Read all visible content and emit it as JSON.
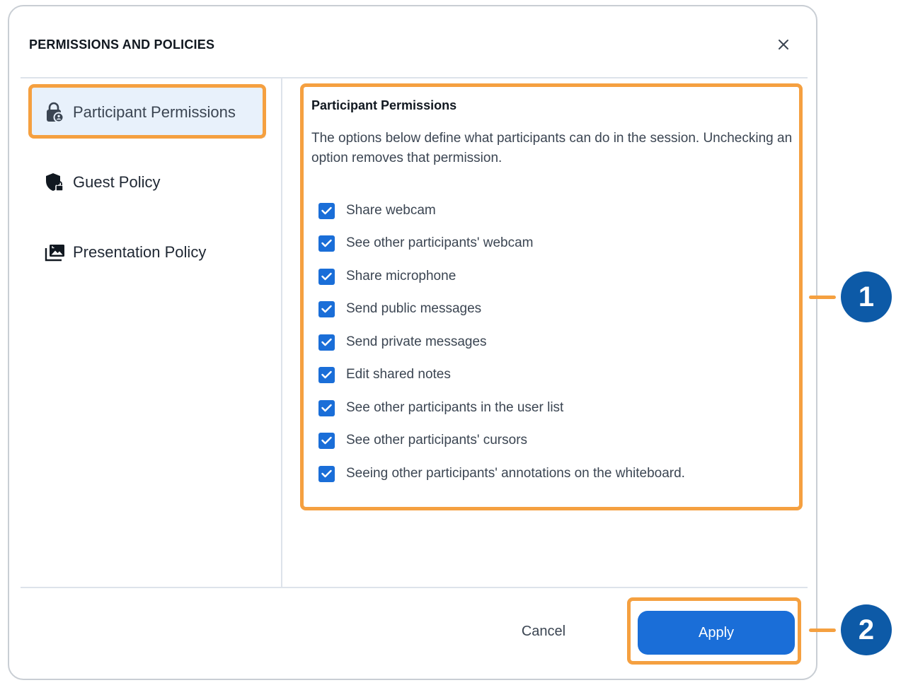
{
  "dialog": {
    "title": "PERMISSIONS AND POLICIES",
    "close_icon": "close-icon"
  },
  "sidebar": {
    "items": [
      {
        "label": "Participant Permissions",
        "icon": "lock-person-icon",
        "active": true
      },
      {
        "label": "Guest Policy",
        "icon": "shield-lock-icon",
        "active": false
      },
      {
        "label": "Presentation Policy",
        "icon": "image-stack-icon",
        "active": false
      }
    ]
  },
  "content": {
    "title": "Participant Permissions",
    "description": "The options below define what participants can do in the session. Unchecking an option removes that permission.",
    "permissions": [
      {
        "label": "Share webcam",
        "checked": true
      },
      {
        "label": "See other participants' webcam",
        "checked": true
      },
      {
        "label": "Share microphone",
        "checked": true
      },
      {
        "label": "Send public messages",
        "checked": true
      },
      {
        "label": "Send private messages",
        "checked": true
      },
      {
        "label": "Edit shared notes",
        "checked": true
      },
      {
        "label": "See other participants in the user list",
        "checked": true
      },
      {
        "label": "See other participants' cursors",
        "checked": true
      },
      {
        "label": "Seeing other participants' annotations on the whiteboard.",
        "checked": true
      }
    ]
  },
  "footer": {
    "cancel_label": "Cancel",
    "apply_label": "Apply"
  },
  "callouts": [
    "1",
    "2"
  ],
  "colors": {
    "accent": "#1a6ed8",
    "highlight": "#f5a040",
    "callout": "#0d5aa7",
    "active_bg": "#e8f1fb"
  }
}
